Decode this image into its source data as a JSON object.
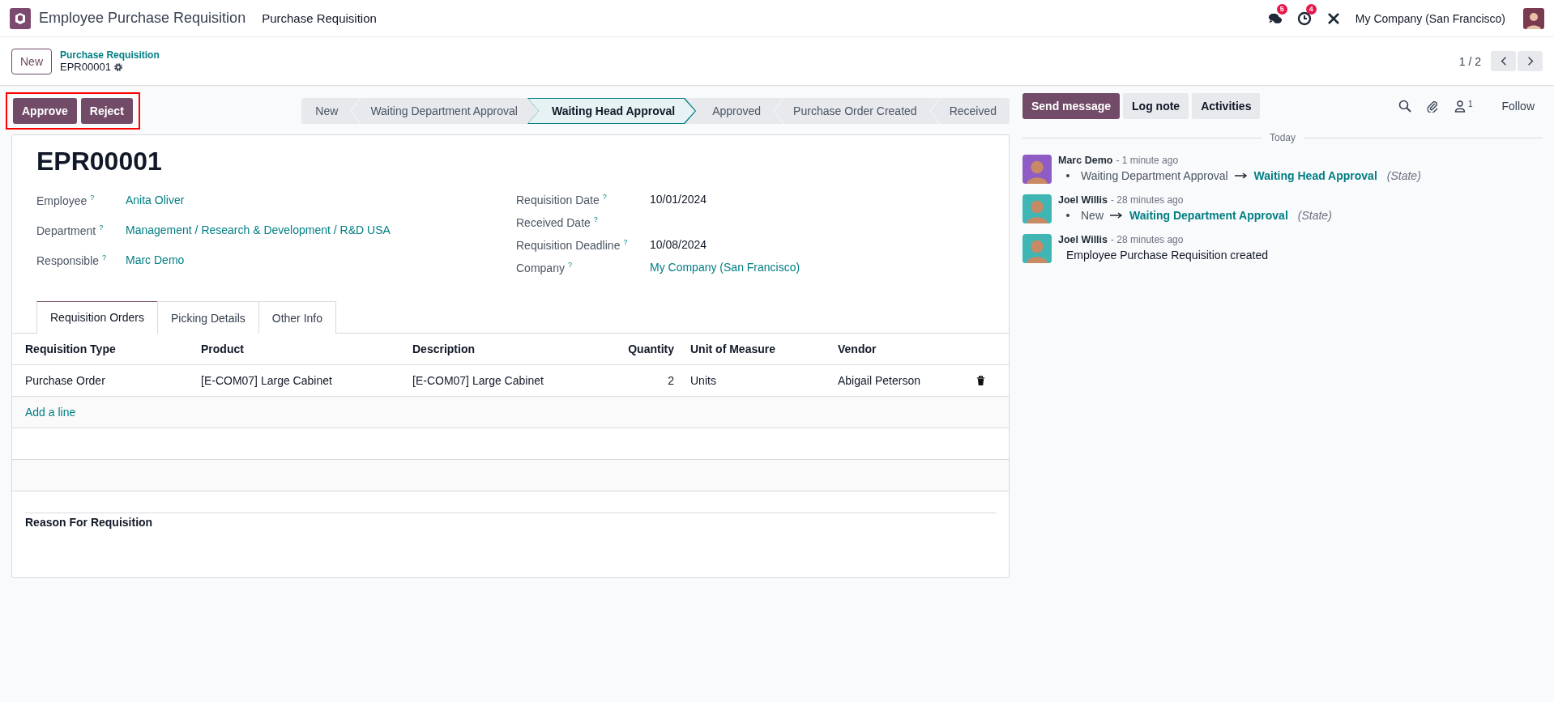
{
  "app": {
    "title": "Employee Purchase Requisition",
    "menu": [
      "Purchase Requisition"
    ]
  },
  "systray": {
    "messages_badge": "5",
    "activities_badge": "4",
    "company": "My Company (San Francisco)"
  },
  "breadcrumb": {
    "new_button": "New",
    "parent": "Purchase Requisition",
    "record": "EPR00001"
  },
  "pager": {
    "value": "1 / 2"
  },
  "actions": {
    "highlighted": true,
    "buttons": [
      "Approve",
      "Reject"
    ]
  },
  "stages": [
    {
      "label": "New",
      "selected": false
    },
    {
      "label": "Waiting Department Approval",
      "selected": false
    },
    {
      "label": "Waiting Head Approval",
      "selected": true
    },
    {
      "label": "Approved",
      "selected": false
    },
    {
      "label": "Purchase Order Created",
      "selected": false
    },
    {
      "label": "Received",
      "selected": false
    }
  ],
  "form": {
    "title": "EPR00001",
    "left_fields": [
      {
        "label": "Employee",
        "help": "?",
        "value": "Anita Oliver",
        "kind": "link"
      },
      {
        "label": "Department",
        "help": "?",
        "value": "Management / Research & Development / R&D USA",
        "kind": "link"
      },
      {
        "label": "Responsible",
        "help": "?",
        "value": "Marc Demo",
        "kind": "link"
      }
    ],
    "right_fields": [
      {
        "label": "Requisition Date",
        "help": "?",
        "value": "10/01/2024",
        "kind": "text"
      },
      {
        "label": "Received Date",
        "help": "?"
      },
      {
        "label": "Requisition Deadline",
        "help": "?",
        "value": "10/08/2024",
        "kind": "text"
      },
      {
        "label": "Company",
        "help": "?",
        "value": "My Company (San Francisco)",
        "kind": "link"
      }
    ],
    "tabs": [
      {
        "label": "Requisition Orders",
        "selected": true
      },
      {
        "label": "Picking Details",
        "selected": false
      },
      {
        "label": "Other Info",
        "selected": false
      }
    ],
    "table": {
      "columns": [
        "Requisition Type",
        "Product",
        "Description",
        "Quantity",
        "Unit of Measure",
        "Vendor"
      ],
      "rows": [
        [
          "Purchase Order",
          "[E-COM07] Large Cabinet",
          "[E-COM07] Large Cabinet",
          "2",
          "Units",
          "Abigail Peterson"
        ]
      ],
      "add_line": "Add a line"
    },
    "reason_label": "Reason For Requisition"
  },
  "chatter": {
    "buttons": [
      {
        "label": "Send message",
        "kind": "primary"
      },
      {
        "label": "Log note",
        "kind": "secondary"
      },
      {
        "label": "Activities",
        "kind": "secondary"
      }
    ],
    "followers_count": "1",
    "follow": "Follow",
    "date_separator": "Today",
    "messages": [
      {
        "author": "Marc Demo",
        "time": "- 1 minute ago",
        "color": "#8e5cc4",
        "kind": "tracking",
        "old": "Waiting Department Approval",
        "new": "Waiting Head Approval",
        "field": "(State)"
      },
      {
        "author": "Joel Willis",
        "time": "- 28 minutes ago",
        "color": "#3fb6b3",
        "kind": "tracking",
        "old": "New",
        "new": "Waiting Department Approval",
        "field": "(State)"
      },
      {
        "author": "Joel Willis",
        "time": "- 28 minutes ago",
        "color": "#3fb6b3",
        "kind": "text",
        "body": "Employee Purchase Requisition created"
      }
    ]
  }
}
